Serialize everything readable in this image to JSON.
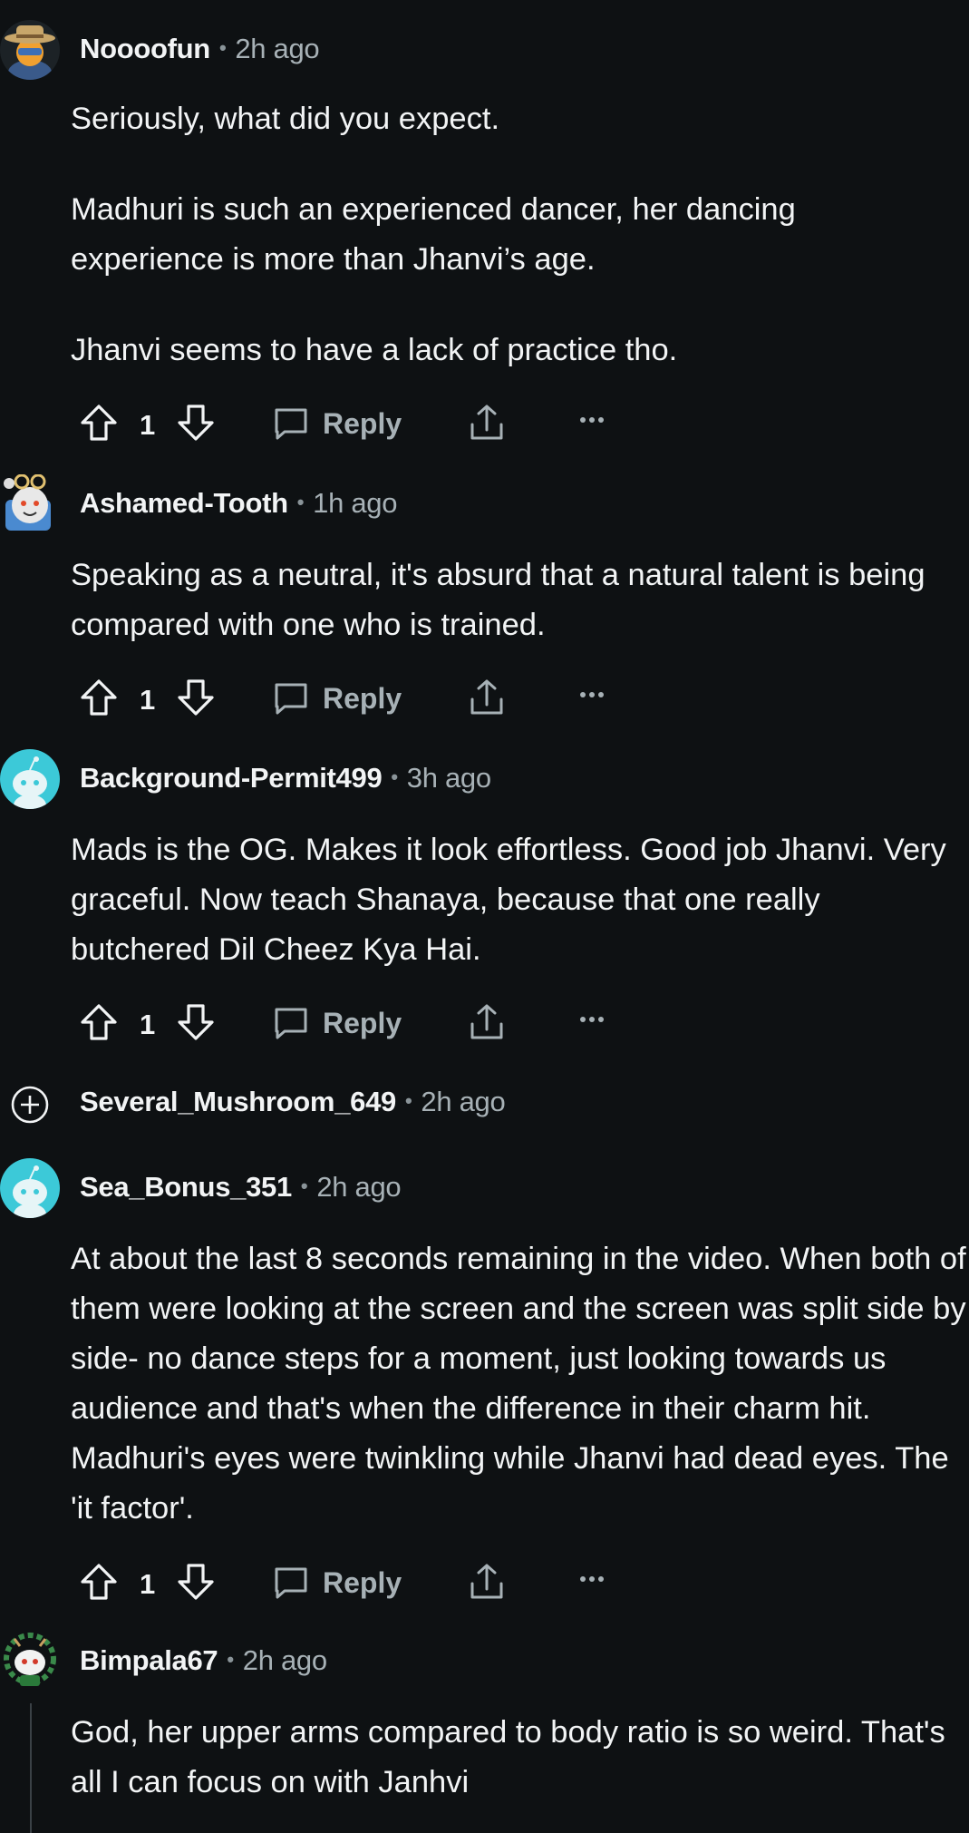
{
  "comments": [
    {
      "username": "Noooofun",
      "time": "2h ago",
      "paragraphs": [
        "Seriously, what did you expect.",
        "Madhuri is such an experienced dancer, her dancing experience is more than Jhanvi’s age.",
        "Jhanvi seems to have a lack of practice tho."
      ],
      "votes": "1",
      "reply_label": "Reply",
      "avatar": "snoo-cowboy-avatar"
    },
    {
      "username": "Ashamed-Tooth",
      "time": "1h ago",
      "paragraphs": [
        "Speaking as a neutral, it's absurd that a natural talent is being compared with one who is trained."
      ],
      "votes": "1",
      "reply_label": "Reply",
      "avatar": "snoo-glasses-avatar"
    },
    {
      "username": "Background-Permit499",
      "time": "3h ago",
      "paragraphs": [
        "Mads is the OG. Makes it look effortless. Good job Jhanvi. Very graceful. Now teach Shanaya, because that one really butchered Dil Cheez Kya Hai."
      ],
      "votes": "1",
      "reply_label": "Reply",
      "avatar": "default-snoo-avatar"
    },
    {
      "username": "Several_Mushroom_649",
      "time": "2h ago",
      "collapsed": true,
      "avatar": "expand-plus-icon"
    },
    {
      "username": "Sea_Bonus_351",
      "time": "2h ago",
      "paragraphs": [
        "At about the last 8 seconds remaining in the video. When both of them were looking at the screen and the screen was split side by side- no dance steps for a moment, just looking towards us audience and that's when the difference in their charm hit. Madhuri's eyes were twinkling while Jhanvi had dead eyes. The 'it factor'."
      ],
      "votes": "1",
      "reply_label": "Reply",
      "avatar": "default-snoo-avatar"
    },
    {
      "username": "Bimpala67",
      "time": "2h ago",
      "paragraphs": [
        "God, her upper arms compared to body ratio is so weird. That's all I can focus on with Janhvi"
      ],
      "avatar": "snoo-wreath-avatar"
    }
  ],
  "colors": {
    "background": "#0e1113",
    "text": "#f2f4f5",
    "muted": "#a7b1b6",
    "default_avatar": "#3cc9d8"
  }
}
